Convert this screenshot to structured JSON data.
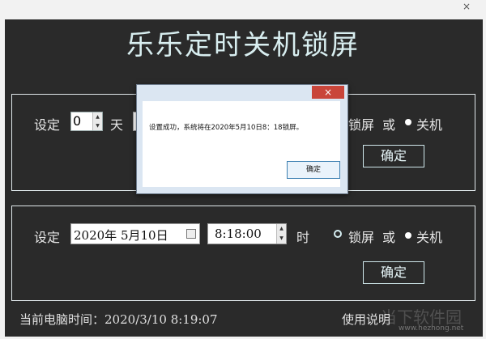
{
  "window": {
    "close_symbol": "×"
  },
  "app": {
    "title": "乐乐定时关机锁屏"
  },
  "section1": {
    "set_label": "设定",
    "days_value": "0",
    "days_unit": "天",
    "lock_label": "锁屏",
    "or_label": "或",
    "shutdown_label": "关机",
    "confirm_label": "确定"
  },
  "dialog": {
    "close_symbol": "×",
    "message": "设置成功，系统将在2020年5月10日8：18锁屏。",
    "ok_label": "确定"
  },
  "section2": {
    "set_label": "设定",
    "date_value": "2020年 5月10日",
    "time_value": "8:18:00",
    "hour_label": "时",
    "lock_label": "锁屏",
    "or_label": "或",
    "shutdown_label": "关机",
    "confirm_label": "确定"
  },
  "status": {
    "current_time_label": "当前电脑时间：",
    "current_time_value": "2020/3/10  8:19:07",
    "usage_label": "使用说明"
  },
  "watermark": {
    "text": "当下软件园",
    "url": "www.hezhong.net"
  }
}
